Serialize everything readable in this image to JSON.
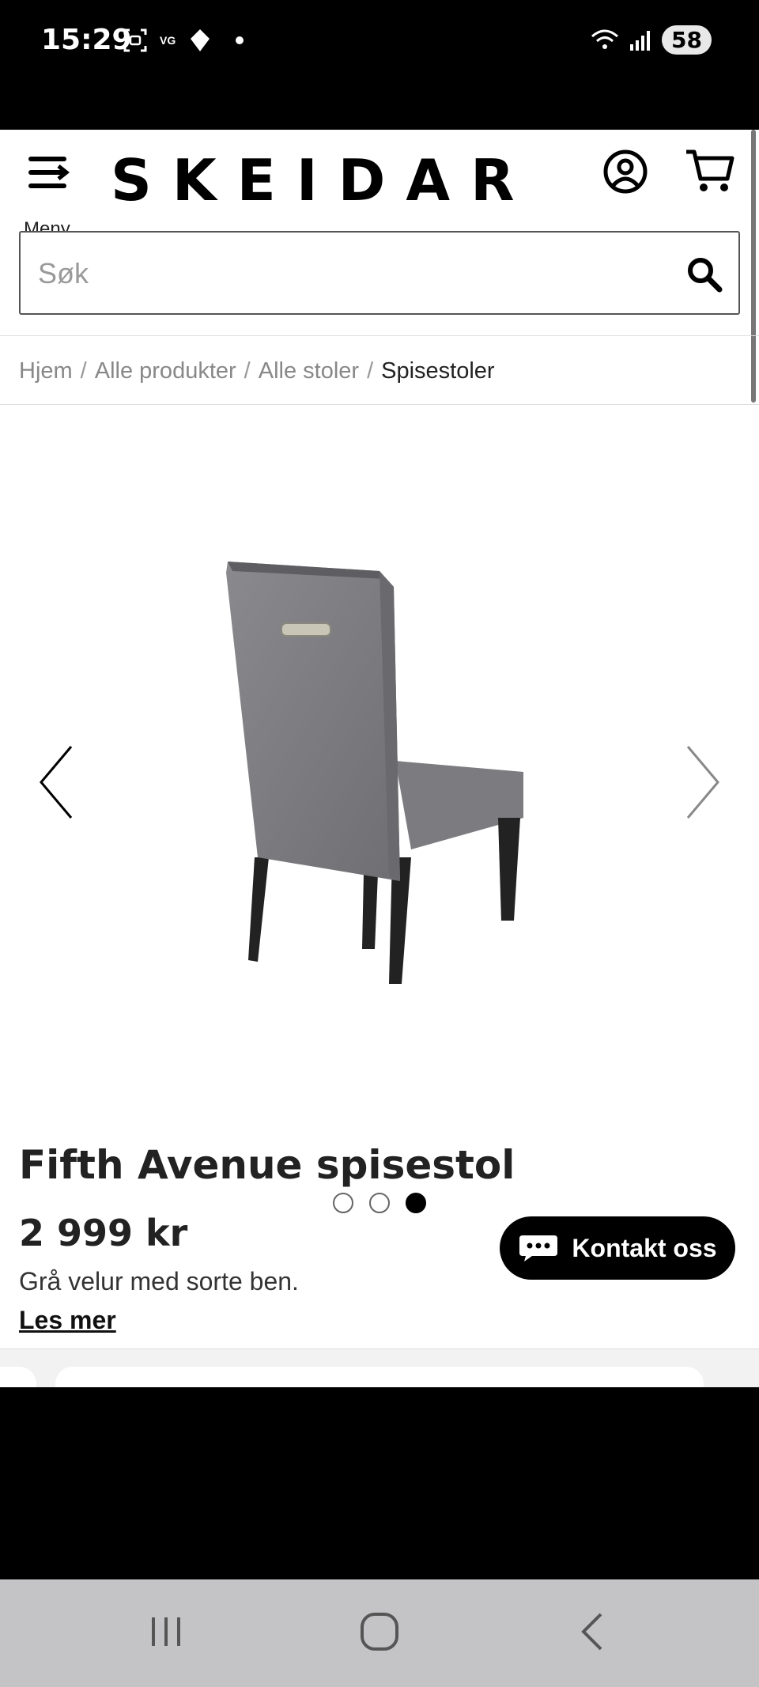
{
  "status_bar": {
    "time": "15:29",
    "vg_label": "VG",
    "battery": "58"
  },
  "header": {
    "menu_label": "Meny",
    "logo_text": "SKEIDAR"
  },
  "search": {
    "placeholder": "Søk"
  },
  "breadcrumb": {
    "items": [
      "Hjem",
      "Alle produkter",
      "Alle stoler"
    ],
    "current": "Spisestoler",
    "separator": "/"
  },
  "gallery": {
    "image_count": 3,
    "active_index": 2
  },
  "product": {
    "title": "Fifth Avenue spisestol",
    "price": "2 999 kr",
    "description": "Grå velur med sorte ben.",
    "read_more": "Les mer"
  },
  "contact": {
    "label": "Kontakt oss"
  },
  "colors": {
    "text": "#222222",
    "accent": "#000000",
    "muted": "#888888",
    "nav_bar": "#c4c4c6"
  }
}
